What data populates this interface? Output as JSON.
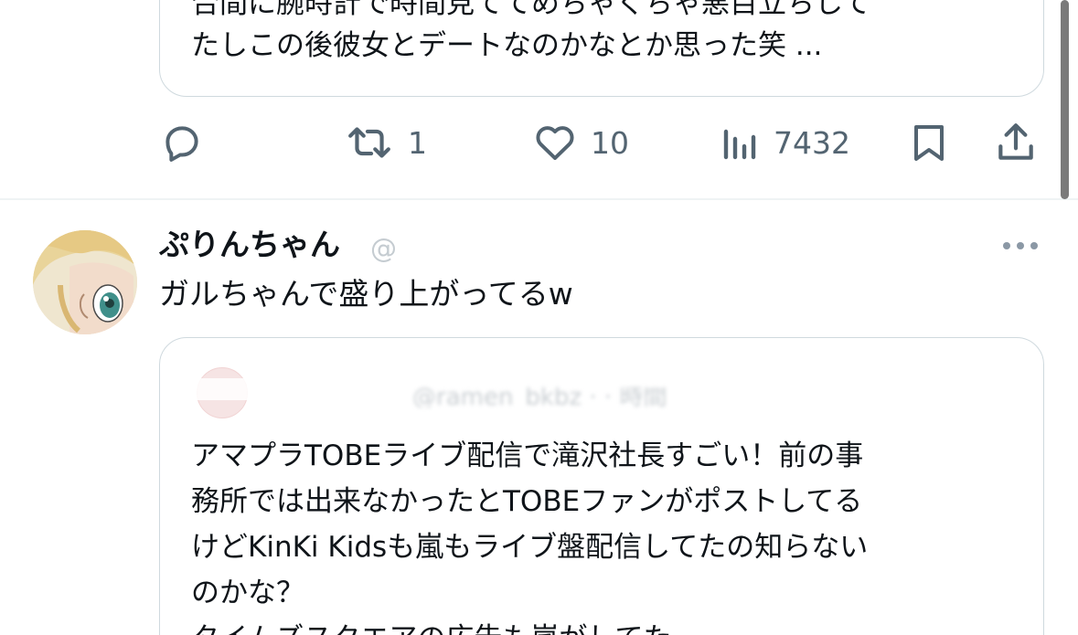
{
  "top_post": {
    "quote_line_cut": "合間に腕時計で時間見ててめちゃくちゃ悪目立ちして",
    "quote_line_last": "たしこの後彼女とデートなのかなとか思った笑 ...",
    "actions": {
      "retweet_count": "1",
      "like_count": "10",
      "views_count": "7432"
    }
  },
  "post": {
    "display_name": "ぷりんちゃん",
    "handle": "@",
    "text": "ガルちゃんで盛り上がってるw",
    "quote": {
      "author_blur": "@ramen_bkbz ·  · 時間",
      "lines": [
        "アマプラTOBEライブ配信で滝沢社長すごい！前の事",
        "務所では出来なかったとTOBEファンがポストしてる",
        "けどKinKi Kidsも嵐もライブ盤配信してたの知らない",
        "のかな？",
        "タイムズスクエアの広告も嵐がしてた"
      ]
    }
  },
  "icons": {
    "reply": "reply-icon",
    "retweet": "retweet-icon",
    "like": "heart-icon",
    "views": "views-icon",
    "bookmark": "bookmark-icon",
    "share": "share-icon",
    "more": "more-icon"
  },
  "colors": {
    "text": "#0f1419",
    "muted": "#536471",
    "border": "#cfd9de"
  }
}
